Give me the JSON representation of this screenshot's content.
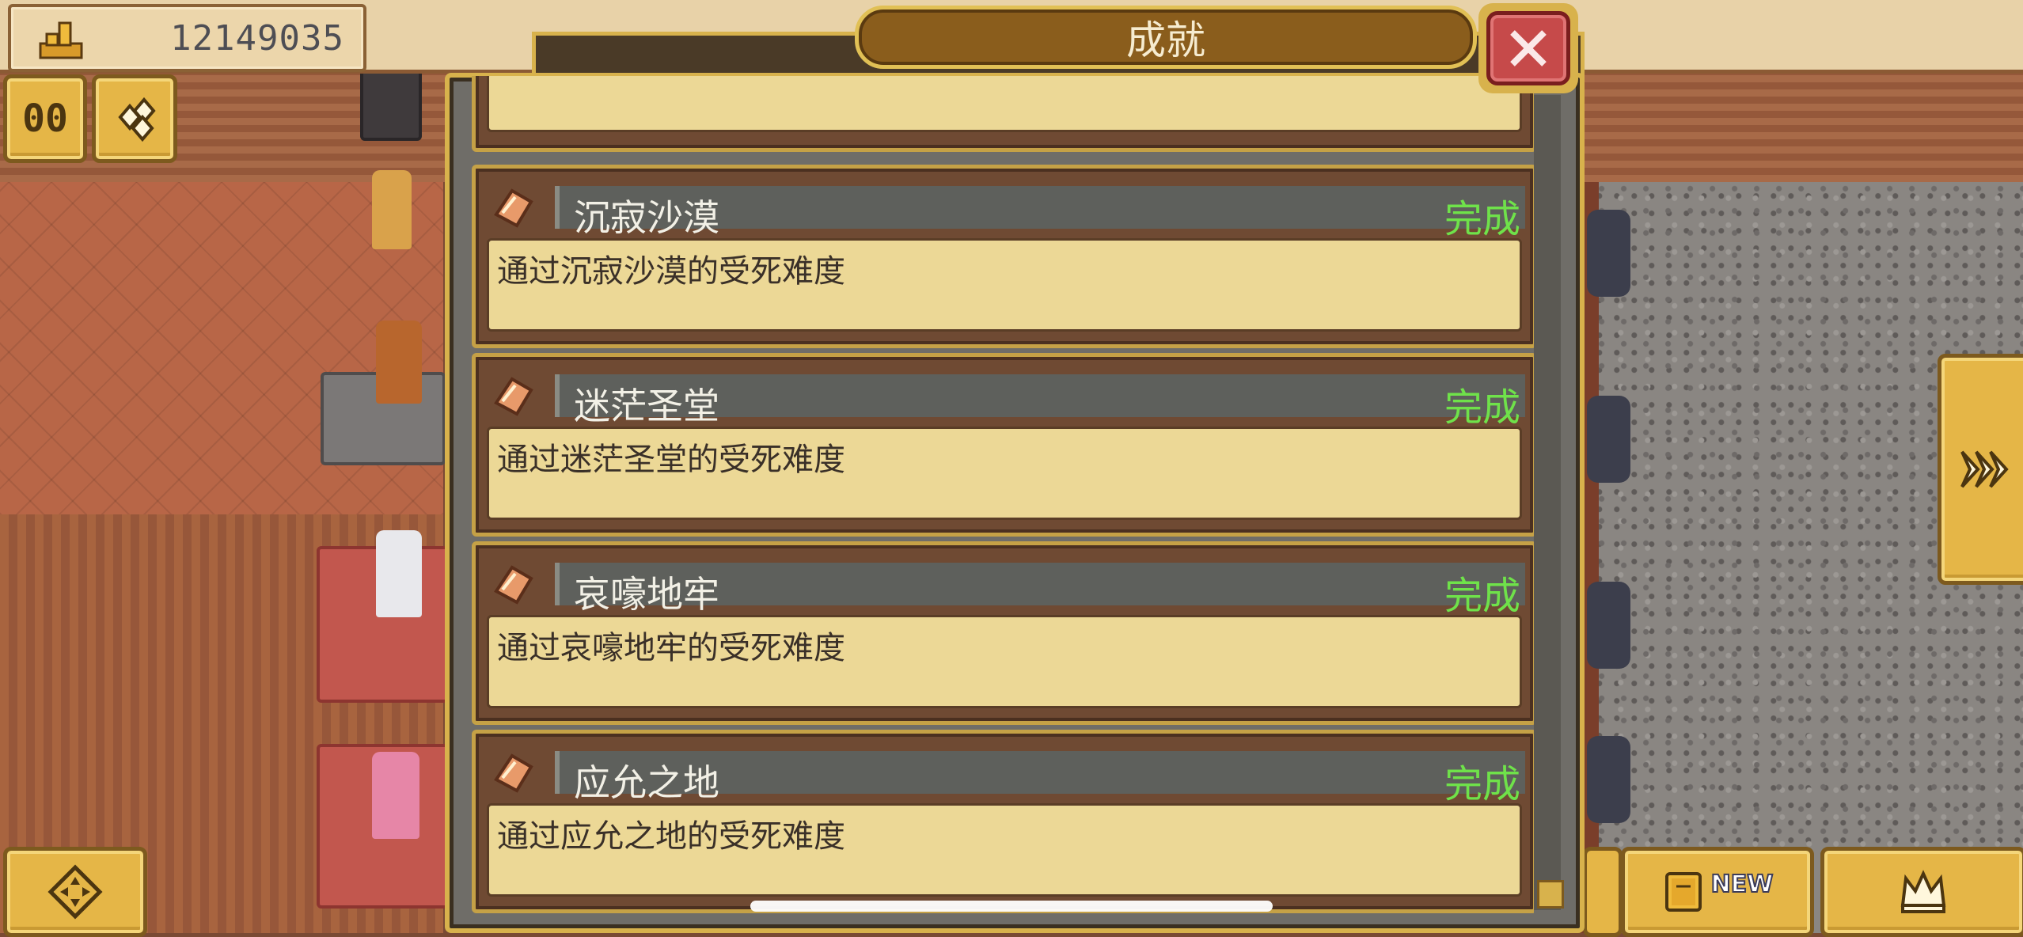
{
  "hud": {
    "gold_value": "12149035",
    "gold_icon": "gold-bars-icon",
    "pause_label": "00",
    "book_badge": "NEW"
  },
  "dialog": {
    "title": "成就",
    "close_icon": "close-x-icon"
  },
  "achievements": [
    {
      "name": "沉寂沙漠",
      "status": "完成",
      "description": "通过沉寂沙漠的受死难度",
      "icon": "parchment-icon"
    },
    {
      "name": "迷茫圣堂",
      "status": "完成",
      "description": "通过迷茫圣堂的受死难度",
      "icon": "parchment-icon"
    },
    {
      "name": "哀嚎地牢",
      "status": "完成",
      "description": "通过哀嚎地牢的受死难度",
      "icon": "parchment-icon"
    },
    {
      "name": "应允之地",
      "status": "完成",
      "description": "通过应允之地的受死难度",
      "icon": "parchment-icon"
    }
  ],
  "colors": {
    "status_complete": "#6fe24a",
    "frame_gold": "#d8b24c",
    "close_red": "#c64a4a"
  }
}
